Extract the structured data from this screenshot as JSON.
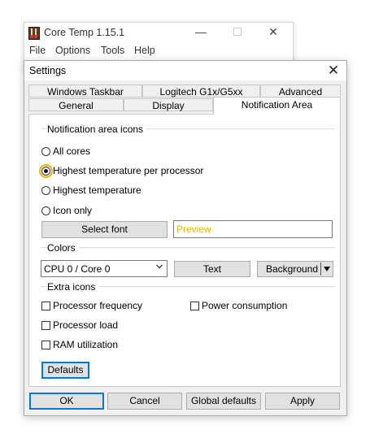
{
  "main_window": {
    "title": "Core Temp 1.15.1",
    "menu": [
      "File",
      "Options",
      "Tools",
      "Help"
    ]
  },
  "dialog": {
    "title": "Settings",
    "tabs_back": [
      "Windows Taskbar",
      "Logitech G1x/G5xx",
      "Advanced"
    ],
    "tabs_front": [
      "General",
      "Display",
      "Notification Area"
    ],
    "active_tab": "Notification Area",
    "notification_icons": {
      "label": "Notification area icons",
      "options": [
        "All cores",
        "Highest temperature per processor",
        "Highest temperature",
        "Icon only"
      ],
      "selected": "Highest temperature per processor"
    },
    "select_font_label": "Select font",
    "preview_text": "Preview",
    "colors": {
      "label": "Colors",
      "combo_value": "CPU 0 / Core 0",
      "text_button": "Text",
      "background_button": "Background"
    },
    "extra_icons": {
      "label": "Extra icons",
      "processor_frequency": "Processor frequency",
      "power_consumption": "Power consumption",
      "processor_load": "Processor load",
      "ram_utilization": "RAM utilization"
    },
    "defaults_label": "Defaults",
    "footer": {
      "ok": "OK",
      "cancel": "Cancel",
      "global_defaults": "Global defaults",
      "apply": "Apply"
    }
  },
  "colors": {
    "accent": "#0078d7",
    "focus": "#f0b400",
    "preview": "#e3b600"
  }
}
